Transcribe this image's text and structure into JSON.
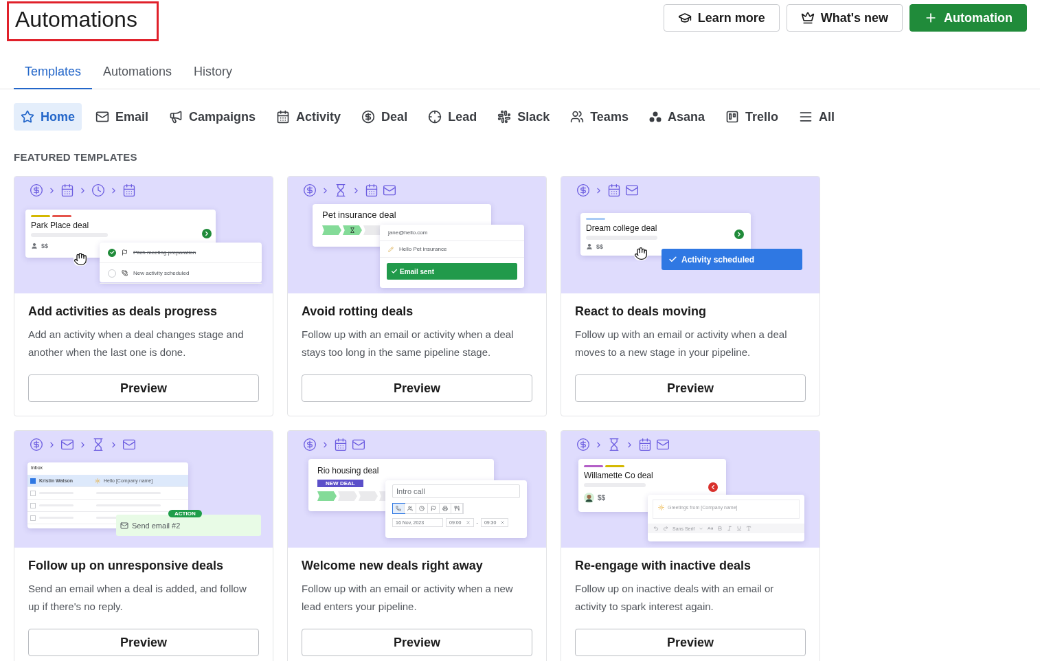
{
  "header": {
    "title": "Automations",
    "buttons": [
      {
        "kind": "learn",
        "label": "Learn more"
      },
      {
        "kind": "news",
        "label": "What's new"
      },
      {
        "kind": "primary",
        "label": "Automation"
      }
    ]
  },
  "tabs": [
    {
      "label": "Templates",
      "selected": true
    },
    {
      "label": "Automations",
      "selected": false
    },
    {
      "label": "History",
      "selected": false
    }
  ],
  "categories": [
    {
      "kind": "home",
      "label": "Home",
      "selected": true
    },
    {
      "kind": "email",
      "label": "Email",
      "selected": false
    },
    {
      "kind": "campaigns",
      "label": "Campaigns",
      "selected": false
    },
    {
      "kind": "activity",
      "label": "Activity",
      "selected": false
    },
    {
      "kind": "deal",
      "label": "Deal",
      "selected": false
    },
    {
      "kind": "lead",
      "label": "Lead",
      "selected": false
    },
    {
      "kind": "slack",
      "label": "Slack",
      "selected": false
    },
    {
      "kind": "teams",
      "label": "Teams",
      "selected": false
    },
    {
      "kind": "asana",
      "label": "Asana",
      "selected": false
    },
    {
      "kind": "trello",
      "label": "Trello",
      "selected": false
    },
    {
      "kind": "all",
      "label": "All",
      "selected": false
    }
  ],
  "section_title": "FEATURED TEMPLATES",
  "templates": [
    {
      "title": "Add activities as deals progress",
      "description": "Add an activity when a deal changes stage and another when the last one is done.",
      "button": "Preview",
      "flow": [
        {
          "kind": "deal"
        },
        {
          "kind": "then"
        },
        {
          "kind": "activity"
        },
        {
          "kind": "then"
        },
        {
          "kind": "delay"
        },
        {
          "kind": "then"
        },
        {
          "kind": "activity"
        }
      ],
      "illustration": {
        "kind": "activity_list",
        "deal": "Park Place deal",
        "tags": [
          {
            "color": "#d4b800"
          },
          {
            "color": "#e5534b"
          }
        ],
        "amount": "$$",
        "overdue": false,
        "items": [
          {
            "text": "Pitch meeting preparation",
            "checked": true
          },
          {
            "text": "New activity scheduled",
            "checked": false
          }
        ]
      }
    },
    {
      "title": "Avoid rotting deals",
      "description": "Follow up with an email or activity when a deal stays too long in the same pipeline stage.",
      "button": "Preview",
      "flow": [
        {
          "kind": "deal"
        },
        {
          "kind": "then"
        },
        {
          "kind": "wait"
        },
        {
          "kind": "then"
        },
        {
          "kind": "activity"
        },
        {
          "kind": "email"
        }
      ],
      "illustration": {
        "kind": "email_sent",
        "deal": "Pet insurance deal",
        "email": "jane@hello.com",
        "subject": "Hello Pet insurance",
        "status": "Email sent"
      }
    },
    {
      "title": "React to deals moving",
      "description": "Follow up with an email or activity when a deal moves to a new stage in your pipeline.",
      "button": "Preview",
      "flow": [
        {
          "kind": "deal"
        },
        {
          "kind": "then"
        },
        {
          "kind": "activity"
        },
        {
          "kind": "email"
        }
      ],
      "illustration": {
        "kind": "activity_scheduled",
        "deal": "Dream college deal",
        "tags": [
          {
            "color": "#a9cbf5"
          }
        ],
        "amount": "$$",
        "overdue": false,
        "status": "Activity scheduled"
      }
    },
    {
      "title": "Follow up on unresponsive deals",
      "description": "Send an email when a deal is added, and follow up if there's no reply.",
      "button": "Preview",
      "flow": [
        {
          "kind": "deal"
        },
        {
          "kind": "then"
        },
        {
          "kind": "email"
        },
        {
          "kind": "then"
        },
        {
          "kind": "wait"
        },
        {
          "kind": "then"
        },
        {
          "kind": "email"
        }
      ],
      "illustration": {
        "kind": "inbox",
        "header": "Inbox",
        "rows": [
          {
            "checked": true,
            "sender": "Kristin Watson",
            "subject": "Hello [Company name]"
          },
          {
            "checked": false
          },
          {
            "checked": false
          },
          {
            "checked": false
          }
        ],
        "badge": "ACTION",
        "action": "Send email #2"
      }
    },
    {
      "title": "Welcome new deals right away",
      "description": "Follow up with an email or activity when a new lead enters your pipeline.",
      "button": "Preview",
      "flow": [
        {
          "kind": "deal"
        },
        {
          "kind": "then"
        },
        {
          "kind": "activity"
        },
        {
          "kind": "email"
        }
      ],
      "illustration": {
        "kind": "activity_form",
        "deal": "Rio housing deal",
        "tag": "NEW DEAL",
        "subject": "Intro call",
        "types": [
          {
            "kind": "call",
            "selected": true
          },
          {
            "kind": "meeting",
            "selected": false
          },
          {
            "kind": "task",
            "selected": false
          },
          {
            "kind": "deadline",
            "selected": false
          },
          {
            "kind": "email",
            "selected": false
          },
          {
            "kind": "lunch",
            "selected": false
          }
        ],
        "date": "16 Nov, 2023",
        "start": "09:00",
        "separator": "-",
        "end": "09:30"
      }
    },
    {
      "title": "Re-engage with inactive deals",
      "description": "Follow up on inactive deals with an email or activity to spark interest again.",
      "button": "Preview",
      "flow": [
        {
          "kind": "deal"
        },
        {
          "kind": "then"
        },
        {
          "kind": "wait"
        },
        {
          "kind": "then"
        },
        {
          "kind": "activity"
        },
        {
          "kind": "email"
        }
      ],
      "illustration": {
        "kind": "editor",
        "deal": "Willamette Co deal",
        "tags": [
          {
            "color": "#b35ec7"
          },
          {
            "color": "#d4b800"
          }
        ],
        "amount": "$$",
        "overdue": true,
        "greeting": "Greetings from [Company name]",
        "font": "Sans Serif"
      }
    }
  ]
}
